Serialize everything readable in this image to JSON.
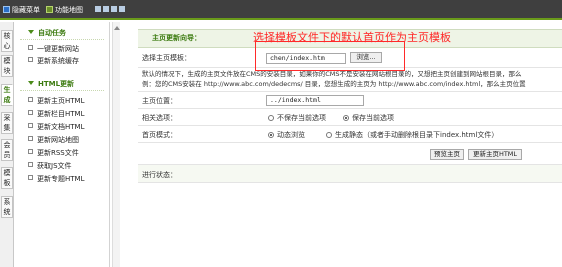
{
  "toolbar": {
    "hide_menu_label": "隐藏菜单",
    "function_map_label": "功能地图"
  },
  "vertical_tabs": [
    {
      "label": "核心"
    },
    {
      "label": "模块"
    },
    {
      "label": "生成"
    },
    {
      "label": "采集"
    },
    {
      "label": "会员"
    },
    {
      "label": "模板"
    },
    {
      "label": "系统"
    }
  ],
  "sidebar": {
    "groups": [
      {
        "title": "自动任务",
        "items": [
          "一键更新网站",
          "更新系统缓存"
        ]
      },
      {
        "title": "HTML更新",
        "items": [
          "更新主页HTML",
          "更新栏目HTML",
          "更新文档HTML",
          "更新网站地图",
          "更新RSS文件",
          "获取JS文件",
          "更新专题HTML"
        ]
      }
    ]
  },
  "main": {
    "header_title": "主页更新向导：",
    "template_label": "选择主页模板：",
    "template_value": "chen/index.htm",
    "browse_button": "浏览...",
    "description_line1": "默认的情况下，生成的主页文件放在CMS的安装目录，如果你的CMS不是安装在网站根目录的，又想把主页创建到网站根目录，那么",
    "description_line2": "例：您的CMS安装在 http://www.abc.com/dedecms/ 目录，您想生成的主页为 http://www.abc.com/index.html，那么主页位置",
    "position_label": "主页位置：",
    "position_value": "../index.html",
    "related_label": "相关选项：",
    "related_options": [
      "不保存当前选项",
      "保存当前选项"
    ],
    "mode_label": "首页模式：",
    "mode_options": [
      "动态浏览",
      "生成静态（或者手动删除根目录下index.html文件）"
    ],
    "preview_button": "预览主页",
    "update_button": "更新主页HTML",
    "progress_label": "进行状态："
  },
  "annotation": {
    "text": "选择模板文件下的默认首页作为主页模板",
    "color": "#ff2626"
  }
}
